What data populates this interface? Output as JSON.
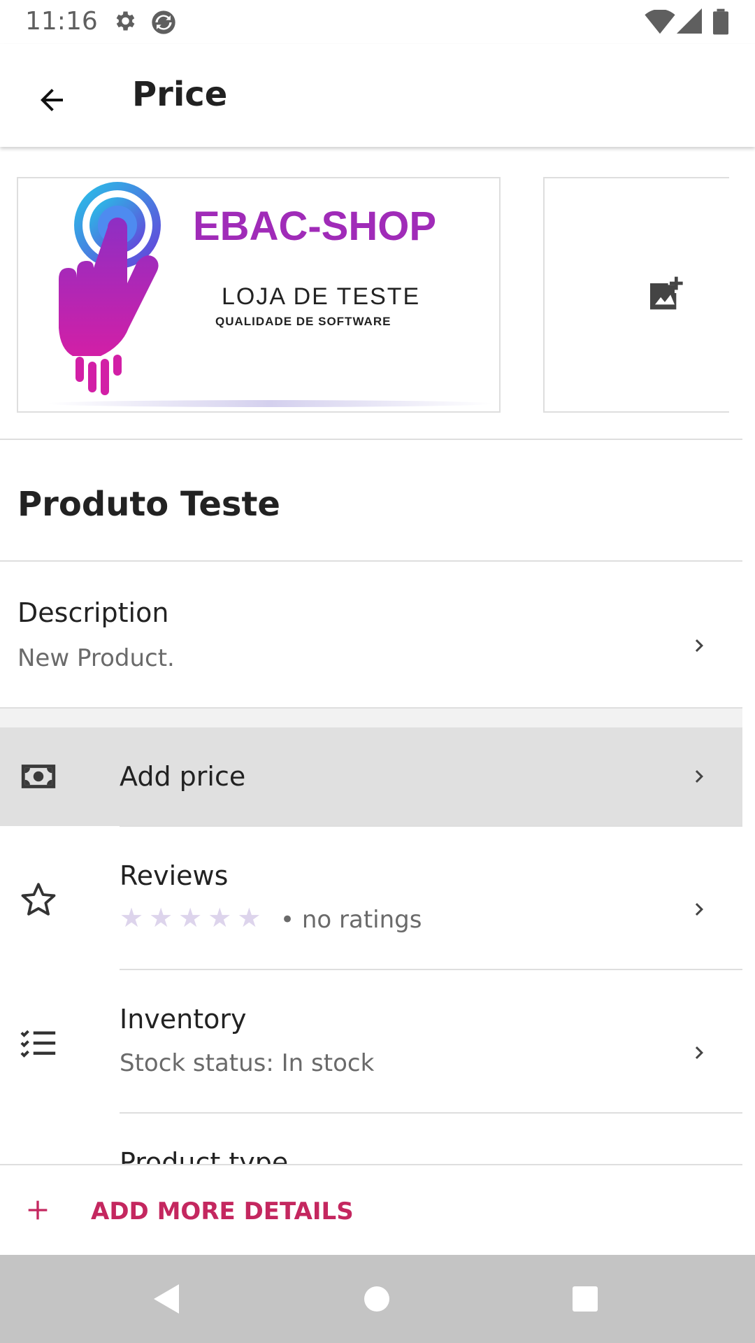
{
  "status_bar": {
    "time": "11:16",
    "icons": [
      "gear-icon",
      "sync-icon",
      "wifi-icon",
      "signal-icon",
      "battery-icon"
    ]
  },
  "app_bar": {
    "back_icon": "arrow-left-icon",
    "title": "Price"
  },
  "images": {
    "logo": {
      "brand": "EBAC-SHOP",
      "line1": "LOJA DE TESTE",
      "line2": "QUALIDADE DE SOFTWARE"
    },
    "add_image_icon": "add-photo-icon"
  },
  "product": {
    "name": "Produto Teste"
  },
  "description": {
    "title": "Description",
    "value": "New Product."
  },
  "rows": {
    "price": {
      "icon": "money-icon",
      "title": "Add price"
    },
    "reviews": {
      "icon": "star-outline-icon",
      "title": "Reviews",
      "rating_stars": 5,
      "rating_text": "• no ratings"
    },
    "inventory": {
      "icon": "checklist-icon",
      "title": "Inventory",
      "value": "Stock status: In stock"
    },
    "product_type": {
      "title": "Product type"
    }
  },
  "add_more": {
    "icon": "plus-icon",
    "label": "ADD MORE DETAILS"
  },
  "colors": {
    "accent": "#c4275f",
    "highlight_row": "#e0e0e0",
    "nav_bar": "#c4c4c4",
    "brand_purple": "#a02bb8"
  }
}
